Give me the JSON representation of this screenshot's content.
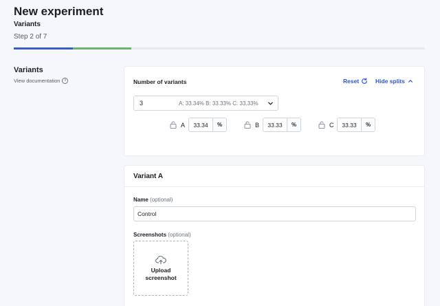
{
  "header": {
    "title": "New experiment",
    "step_title": "Variants",
    "step_count": "Step 2 of 7",
    "progress": {
      "completed_steps": 2,
      "total_steps": 7,
      "colors": [
        "#3b5bc9",
        "#6ab36a"
      ]
    }
  },
  "sidebar": {
    "section_title": "Variants",
    "doc_link": "View documentation",
    "doc_icon": "info-icon"
  },
  "variants_card": {
    "label": "Number of variants",
    "reset_label": "Reset",
    "reset_icon": "refresh-icon",
    "hide_label": "Hide splits",
    "hide_icon": "chevron-up-icon",
    "select_value": "3",
    "select_splits": "A: 33.34%  B: 33.33%  C: 33.33%",
    "splits": [
      {
        "letter": "A",
        "value": "33.34",
        "unit": "%"
      },
      {
        "letter": "B",
        "value": "33.33",
        "unit": "%"
      },
      {
        "letter": "C",
        "value": "33.33",
        "unit": "%"
      }
    ]
  },
  "variant_a_card": {
    "title": "Variant A",
    "name_label": "Name",
    "name_optional": "(optional)",
    "name_value": "Control",
    "screenshots_label": "Screenshots",
    "screenshots_optional": "(optional)",
    "upload_label": "Upload screenshot",
    "upload_icon": "cloud-upload-icon"
  },
  "colors": {
    "accent": "#2d55d1",
    "background": "#f5f7fa"
  }
}
